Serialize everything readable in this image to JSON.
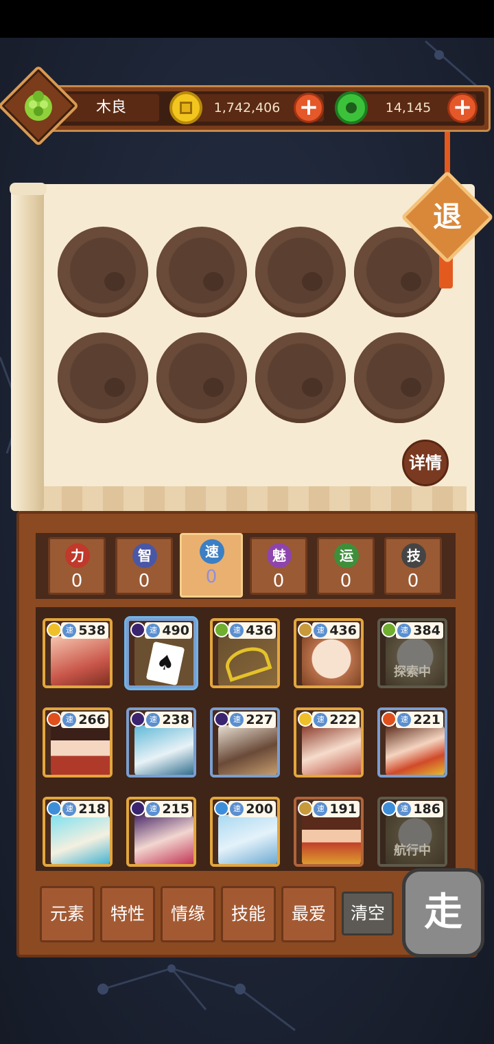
{
  "header": {
    "player_name": "木良",
    "coins": "1,742,406",
    "jade": "14,145",
    "plus_label": "+"
  },
  "exit_label": "退",
  "detail_label": "详情",
  "stats": [
    {
      "label": "力",
      "value": "0",
      "color": "#c0392b"
    },
    {
      "label": "智",
      "value": "0",
      "color": "#4a57a6"
    },
    {
      "label": "速",
      "value": "0",
      "color": "#3b7fc4"
    },
    {
      "label": "魅",
      "value": "0",
      "color": "#8e44ad"
    },
    {
      "label": "运",
      "value": "0",
      "color": "#3f8f3a"
    },
    {
      "label": "技",
      "value": "0",
      "color": "#444444"
    }
  ],
  "cards": [
    {
      "value": "538",
      "element": "#f0c02a",
      "status": ""
    },
    {
      "value": "490",
      "element": "#3a2470",
      "status": ""
    },
    {
      "value": "436",
      "element": "#6fae2e",
      "status": ""
    },
    {
      "value": "436",
      "element": "#c89a3a",
      "status": ""
    },
    {
      "value": "384",
      "element": "#6fae2e",
      "status": "探索中"
    },
    {
      "value": "266",
      "element": "#e0501c",
      "status": ""
    },
    {
      "value": "238",
      "element": "#3a2470",
      "status": ""
    },
    {
      "value": "227",
      "element": "#3a2470",
      "status": ""
    },
    {
      "value": "222",
      "element": "#f0c02a",
      "status": ""
    },
    {
      "value": "221",
      "element": "#e0501c",
      "status": ""
    },
    {
      "value": "218",
      "element": "#3d8ed8",
      "status": ""
    },
    {
      "value": "215",
      "element": "#3a2470",
      "status": ""
    },
    {
      "value": "200",
      "element": "#3d8ed8",
      "status": ""
    },
    {
      "value": "191",
      "element": "#c89a3a",
      "status": ""
    },
    {
      "value": "186",
      "element": "#3d8ed8",
      "status": "航行中"
    }
  ],
  "speed_label": "速",
  "filters": [
    "元素",
    "特性",
    "情缘",
    "技能",
    "最爱",
    "清空"
  ],
  "go_label": "走"
}
